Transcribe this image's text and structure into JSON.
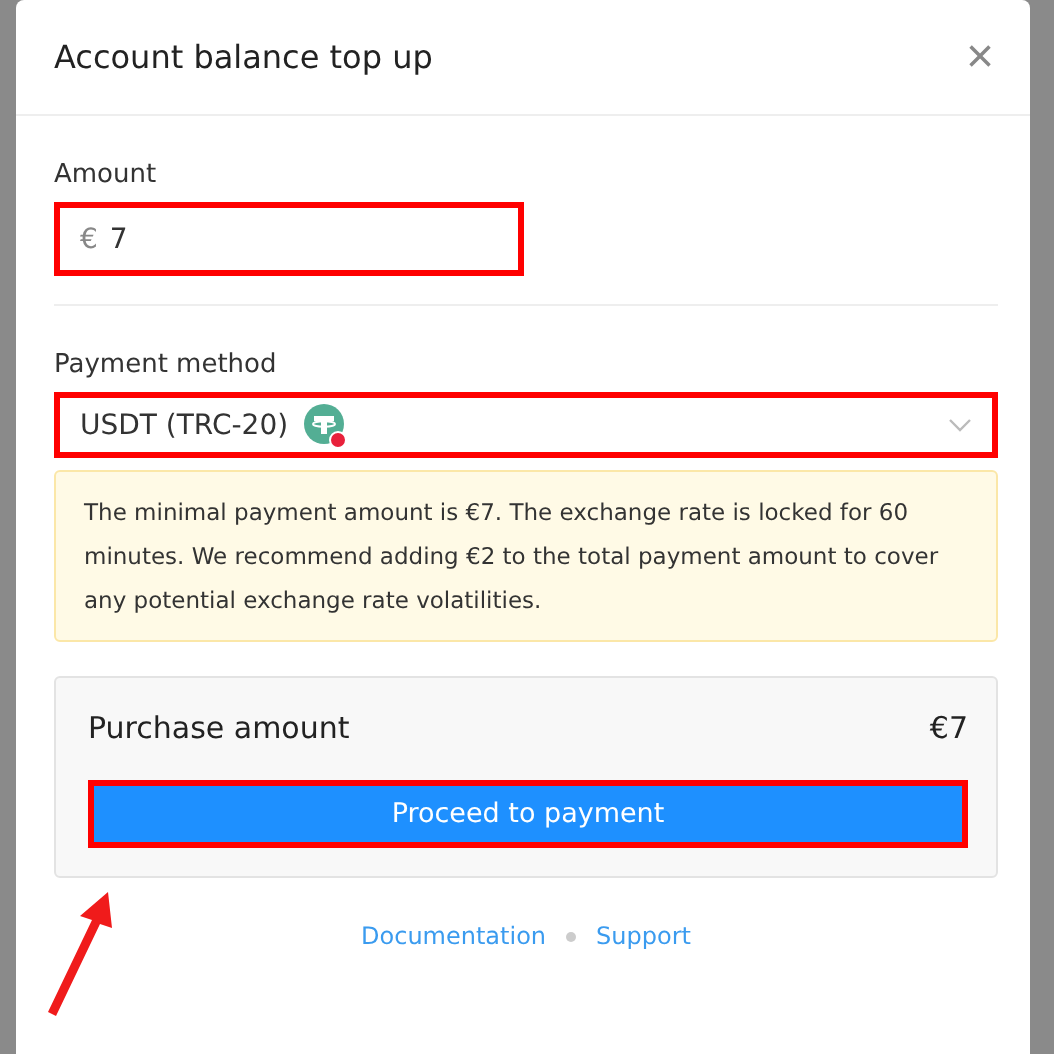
{
  "dialog": {
    "title": "Account balance top up",
    "close": "×"
  },
  "amount": {
    "label": "Amount",
    "currency": "€",
    "value": "7",
    "highlighted": true
  },
  "payment_method": {
    "label": "Payment method",
    "value": "USDT (TRC-20)",
    "highlighted": true
  },
  "notice": "The minimal payment amount is €7. The exchange rate is locked for 60 minutes. We recommend adding €2 to the total payment amount to cover any potential exchange rate volatilities.",
  "summary": {
    "label": "Purchase amount",
    "value": "€7"
  },
  "proceed_button": {
    "label": "Proceed to payment",
    "highlighted": true
  },
  "footer_links": [
    "Documentation",
    "Support"
  ]
}
